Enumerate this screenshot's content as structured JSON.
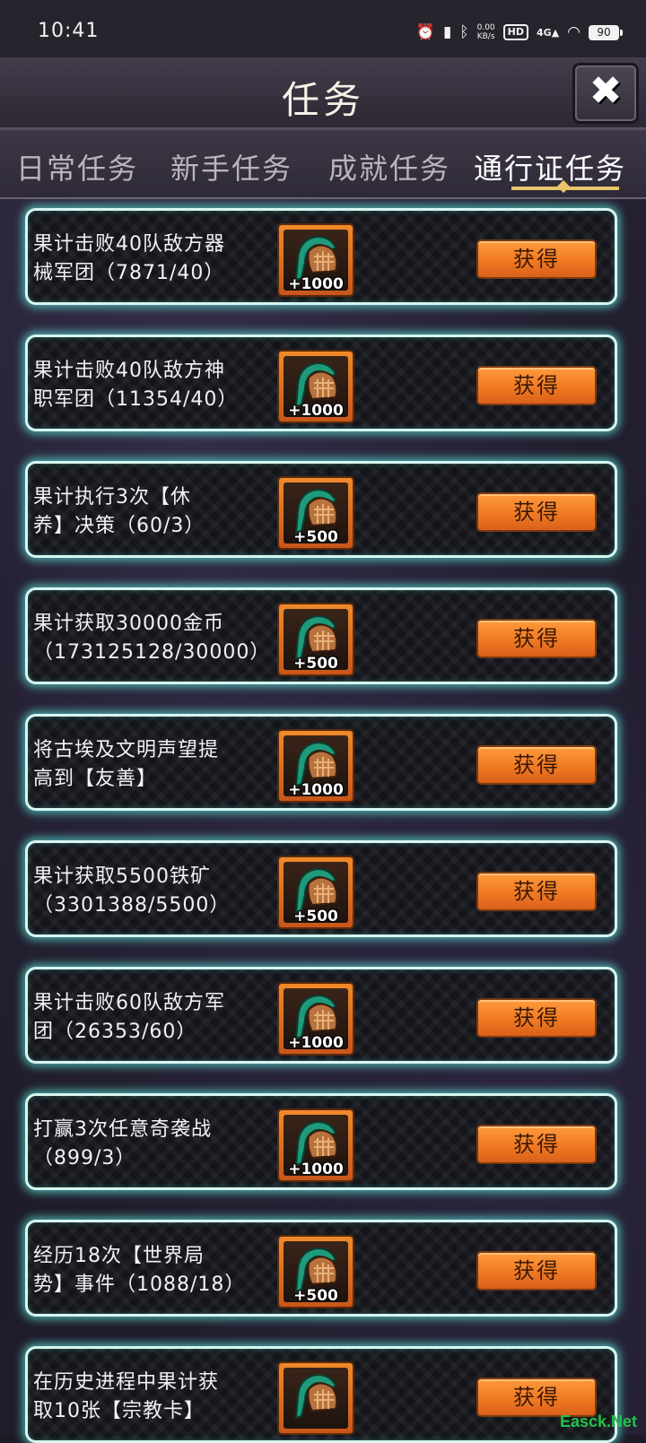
{
  "status_bar": {
    "time": "10:41",
    "net_speed": "0.00",
    "net_unit": "KB/s",
    "hd": "HD",
    "signal": "4G",
    "battery": "90"
  },
  "header": {
    "title": "任务",
    "close_label": "✖"
  },
  "tabs": [
    {
      "label": "日常任务",
      "active": false
    },
    {
      "label": "新手任务",
      "active": false
    },
    {
      "label": "成就任务",
      "active": false
    },
    {
      "label": "通行证任务",
      "active": true
    }
  ],
  "tasks": [
    {
      "line1": "果计击败40队敌方器",
      "line2": "械军团（7871/40）",
      "reward": "+1000",
      "button": "获得"
    },
    {
      "line1": "果计击败40队敌方神",
      "line2": "职军团（11354/40）",
      "reward": "+1000",
      "button": "获得"
    },
    {
      "line1": "果计执行3次【休",
      "line2": "养】决策（60/3）",
      "reward": "+500",
      "button": "获得"
    },
    {
      "line1": "果计获取30000金币",
      "line2": "（173125128/30000）",
      "reward": "+500",
      "button": "获得"
    },
    {
      "line1": "将古埃及文明声望提",
      "line2": "高到【友善】",
      "reward": "+1000",
      "button": "获得"
    },
    {
      "line1": "果计获取5500铁矿",
      "line2": "（3301388/5500）",
      "reward": "+500",
      "button": "获得"
    },
    {
      "line1": "果计击败60队敌方军",
      "line2": "团（26353/60）",
      "reward": "+1000",
      "button": "获得"
    },
    {
      "line1": "打赢3次任意奇袭战",
      "line2": "（899/3）",
      "reward": "+1000",
      "button": "获得"
    },
    {
      "line1": "经历18次【世界局",
      "line2": "势】事件（1088/18）",
      "reward": "+500",
      "button": "获得"
    },
    {
      "line1": "在历史进程中果计获",
      "line2": "取10张【宗教卡】",
      "reward": "",
      "button": "获得"
    }
  ],
  "watermark": "Easck.Net",
  "colors": {
    "card_glow": "#5adcd2",
    "button": "#f07a22",
    "tab_indicator": "#e9c46a"
  }
}
